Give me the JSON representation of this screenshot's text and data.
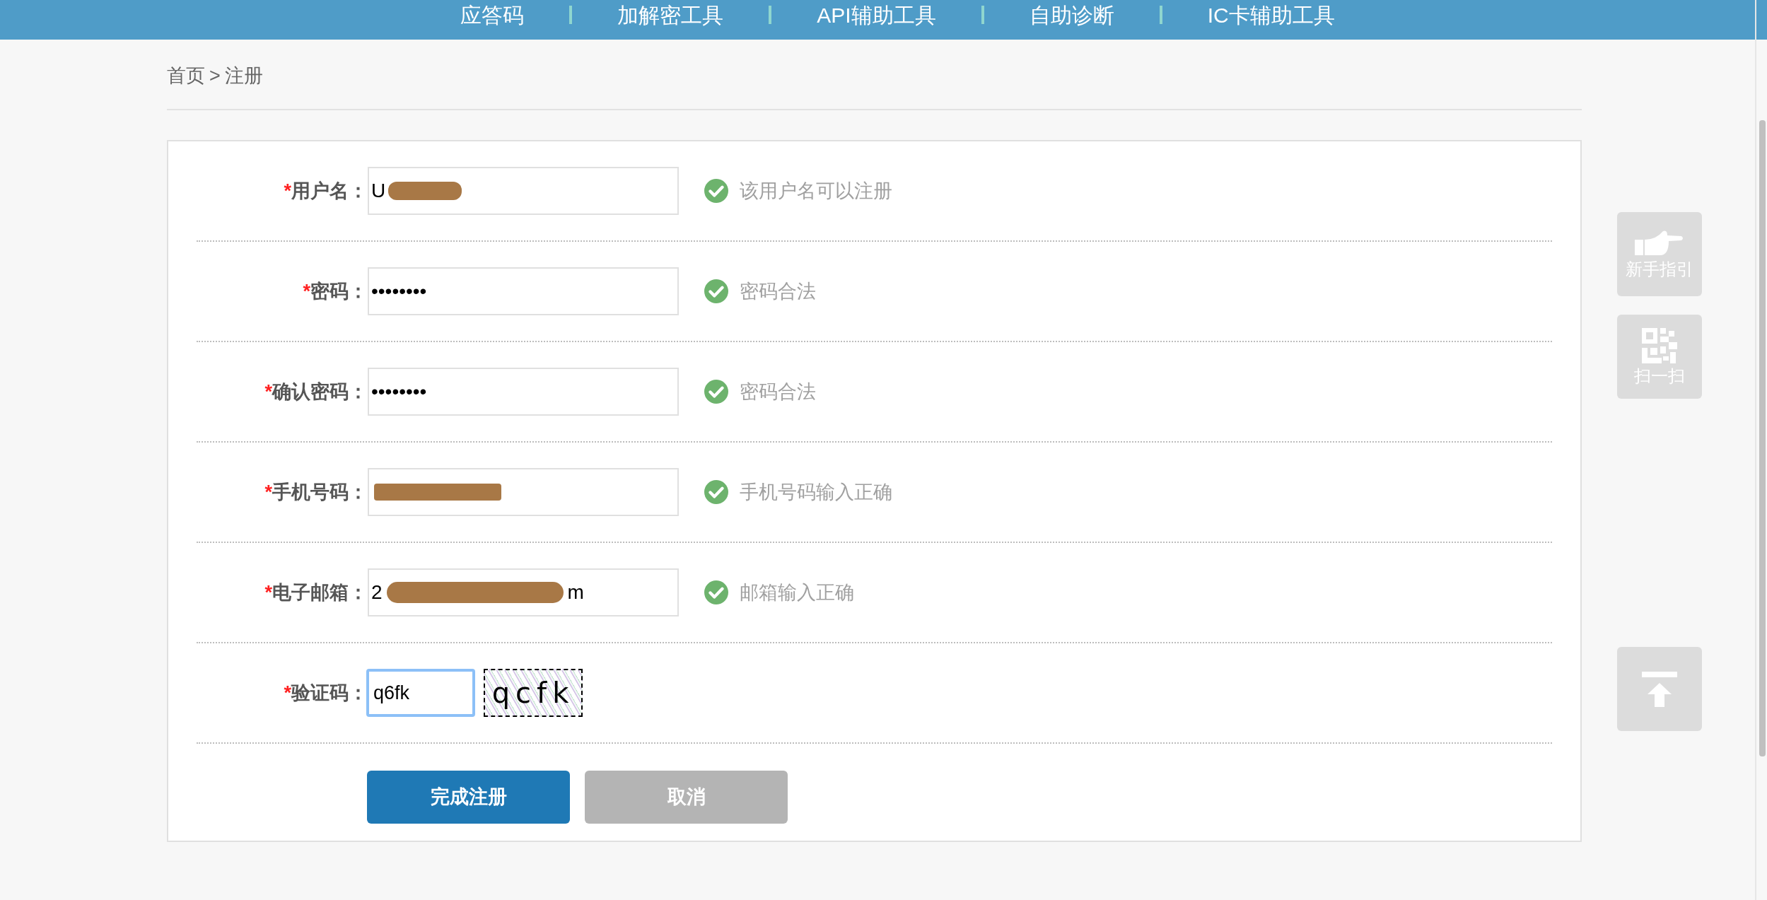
{
  "nav": {
    "items": [
      {
        "label": "应答码"
      },
      {
        "label": "加解密工具"
      },
      {
        "label": "API辅助工具"
      },
      {
        "label": "自助诊断"
      },
      {
        "label": "IC卡辅助工具"
      }
    ]
  },
  "breadcrumb": {
    "home": "首页",
    "separator": ">",
    "current": "注册"
  },
  "form": {
    "fields": [
      {
        "kind": "text",
        "required": "*",
        "label": "用户名：",
        "value": "U",
        "redacted": true,
        "status": {
          "valid": true,
          "message": "该用户名可以注册"
        }
      },
      {
        "kind": "text",
        "required": "*",
        "label": "密码：",
        "value": "••••••••",
        "status": {
          "valid": true,
          "message": "密码合法"
        }
      },
      {
        "kind": "text",
        "required": "*",
        "label": "确认密码：",
        "value": "••••••••",
        "status": {
          "valid": true,
          "message": "密码合法"
        }
      },
      {
        "kind": "text",
        "required": "*",
        "label": "手机号码：",
        "redacted": true,
        "status": {
          "valid": true,
          "message": "手机号码输入正确"
        }
      },
      {
        "kind": "text",
        "required": "*",
        "label": "电子邮箱：",
        "value": "2",
        "value_end": "m",
        "redacted": true,
        "status": {
          "valid": true,
          "message": "邮箱输入正确"
        }
      },
      {
        "kind": "captcha",
        "required": "*",
        "label": "验证码：",
        "value": "q6fk",
        "focused": true,
        "captcha_text": "qcfk"
      }
    ],
    "buttons": [
      {
        "label": "完成注册",
        "kind": "primary"
      },
      {
        "label": "取消",
        "kind": "secondary"
      }
    ]
  },
  "side_tools": [
    {
      "kind": "guide",
      "label": "新手指引"
    },
    {
      "kind": "qr",
      "label": "扫一扫"
    },
    {
      "kind": "top"
    }
  ]
}
